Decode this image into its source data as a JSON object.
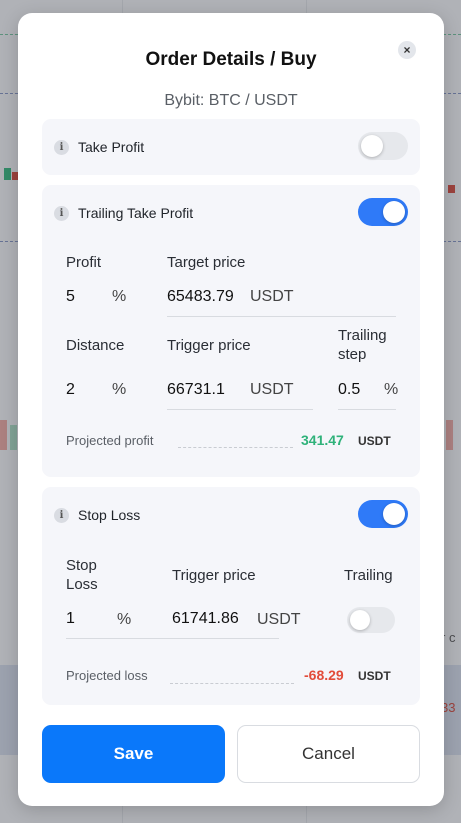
{
  "title": "Order Details / Buy",
  "subtitle": "Bybit: BTC / USDT",
  "close_icon": "×",
  "info_icon": "i",
  "take_profit": {
    "label": "Take Profit",
    "enabled": false
  },
  "trailing_take_profit": {
    "label": "Trailing Take Profit",
    "enabled": true,
    "profit_label": "Profit",
    "profit_value": "5",
    "profit_unit": "%",
    "target_price_label": "Target price",
    "target_price_value": "65483.79",
    "target_price_unit": "USDT",
    "distance_label": "Distance",
    "distance_value": "2",
    "distance_unit": "%",
    "trigger_price_label": "Trigger price",
    "trigger_price_value": "66731.1",
    "trigger_price_unit": "USDT",
    "trailing_step_label": "Trailing step",
    "trailing_step_value": "0.5",
    "trailing_step_unit": "%",
    "projected_label": "Projected profit",
    "projected_value": "341.47",
    "projected_unit": "USDT"
  },
  "stop_loss": {
    "label": "Stop Loss",
    "enabled": true,
    "stop_loss_label": "Stop Loss",
    "stop_loss_value": "1",
    "stop_loss_unit": "%",
    "trigger_price_label": "Trigger price",
    "trigger_price_value": "61741.86",
    "trigger_price_unit": "USDT",
    "trailing_label": "Trailing",
    "trailing_enabled": false,
    "projected_label": "Projected loss",
    "projected_value": "-68.29",
    "projected_unit": "USDT"
  },
  "buttons": {
    "save": "Save",
    "cancel": "Cancel"
  },
  "colors": {
    "accent": "#2f7af8",
    "save_button": "#0a78fa",
    "profit_green": "#2fb27a",
    "loss_red": "#e24c3a"
  },
  "background_text": {
    "right_fragment": "r c",
    "right_red_fragment": "33"
  }
}
